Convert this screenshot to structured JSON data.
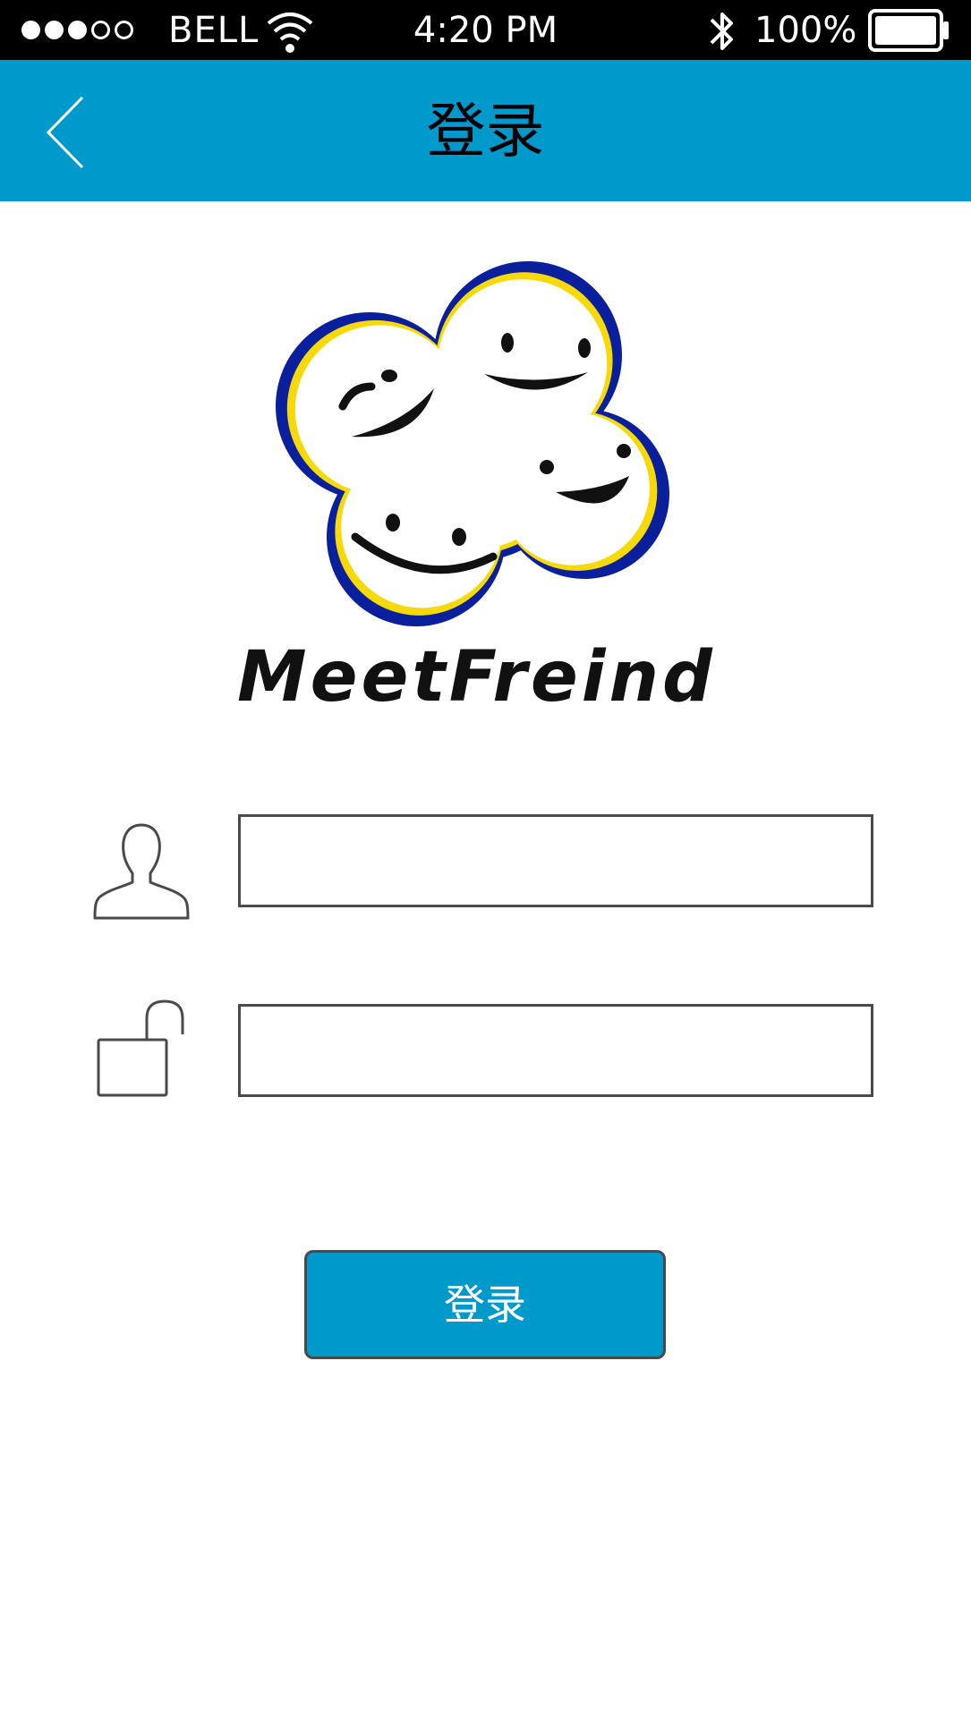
{
  "status_bar": {
    "signal_dots": [
      "filled",
      "filled",
      "filled",
      "empty",
      "empty"
    ],
    "carrier": "BELL",
    "time": "4:20 PM",
    "battery_percent": "100%",
    "battery_level": 1.0
  },
  "nav": {
    "back_icon": "chevron-left-icon",
    "title": "登录"
  },
  "logo": {
    "graphic": "smiling-cloud-faces-logo",
    "wordmark": "MeetFreind"
  },
  "form": {
    "username": {
      "icon": "user-icon",
      "value": "",
      "placeholder": ""
    },
    "password": {
      "icon": "unlocked-padlock-icon",
      "value": "",
      "placeholder": ""
    },
    "submit_label": "登录"
  },
  "colors": {
    "accent": "#0099cc",
    "status_bar": "#000000",
    "field_border": "#4a4a4a",
    "logo_outline": "#0a1f9c",
    "logo_glow": "#f5d90a"
  }
}
